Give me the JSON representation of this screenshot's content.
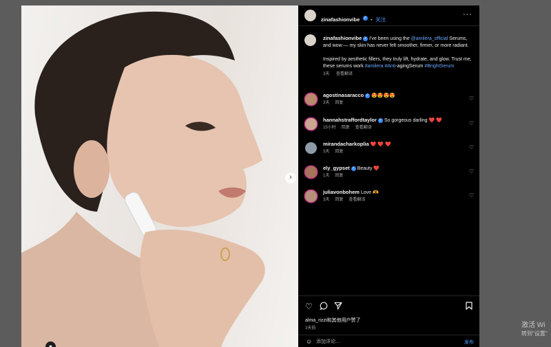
{
  "post": {
    "author": "zinafashionvibe",
    "follow_label": "关注",
    "more_label": "···",
    "caption_p1_prefix": "I've been using the ",
    "caption_p1_mention": "@amilera_official",
    "caption_p1_suffix": " Serums, and wow — my skin has never felt smoother, firmer, or more radiant.",
    "caption_p2_prefix": "Inspired by aesthetic fillers, they truly lift, hydrate, and glow. Trust me, these serums work ",
    "caption_p2_tags": "#amilera #Anti",
    "caption_p2_mid": "-agingSerum ",
    "caption_p2_tag2": "#BrightSerum",
    "caption_age": "3天",
    "caption_translate": "查看翻译"
  },
  "comments": [
    {
      "user": "agostinasaracco",
      "verified": true,
      "text": "😍😍😍😍",
      "age": "3天",
      "reply": "回复",
      "translate": ""
    },
    {
      "user": "hannahstraffordtaylor",
      "verified": true,
      "text": "So gorgeous darling ❤️ ❤️",
      "age": "15小时",
      "reply": "回复",
      "translate": "查看翻译"
    },
    {
      "user": "mirandacharkoplia",
      "verified": false,
      "text": "❤️ ❤️ ❤️",
      "age": "3天",
      "reply": "回复",
      "translate": ""
    },
    {
      "user": "ely_gypset",
      "verified": true,
      "text": "Beauty ❤️",
      "age": "1天",
      "reply": "回复",
      "translate": ""
    },
    {
      "user": "juliavonbohem",
      "verified": false,
      "text": "Love 🫶",
      "age": "3天",
      "reply": "回复",
      "translate": "查看翻译"
    }
  ],
  "actions": {
    "like_icon": "heart-outline-icon",
    "comment_icon": "comment-bubble-icon",
    "share_icon": "paper-plane-icon",
    "save_icon": "bookmark-icon"
  },
  "likes_text": "alma_rizzi和其他用户赞了",
  "post_age": "3天前",
  "add_comment": {
    "placeholder": "添加评论...",
    "post_label": "发布",
    "emoji_icon": "smiley-icon"
  },
  "carousel": {
    "next_icon": "chevron-right-icon",
    "slides": 6,
    "active": 0,
    "tag_icon": "user-tag-icon"
  },
  "watermark": {
    "line1": "激活 Wi",
    "line2": "转到\"设置\""
  },
  "colors": {
    "accent": "#3b8cff",
    "heart_red": "#ff3040",
    "panel_bg": "#000000"
  }
}
